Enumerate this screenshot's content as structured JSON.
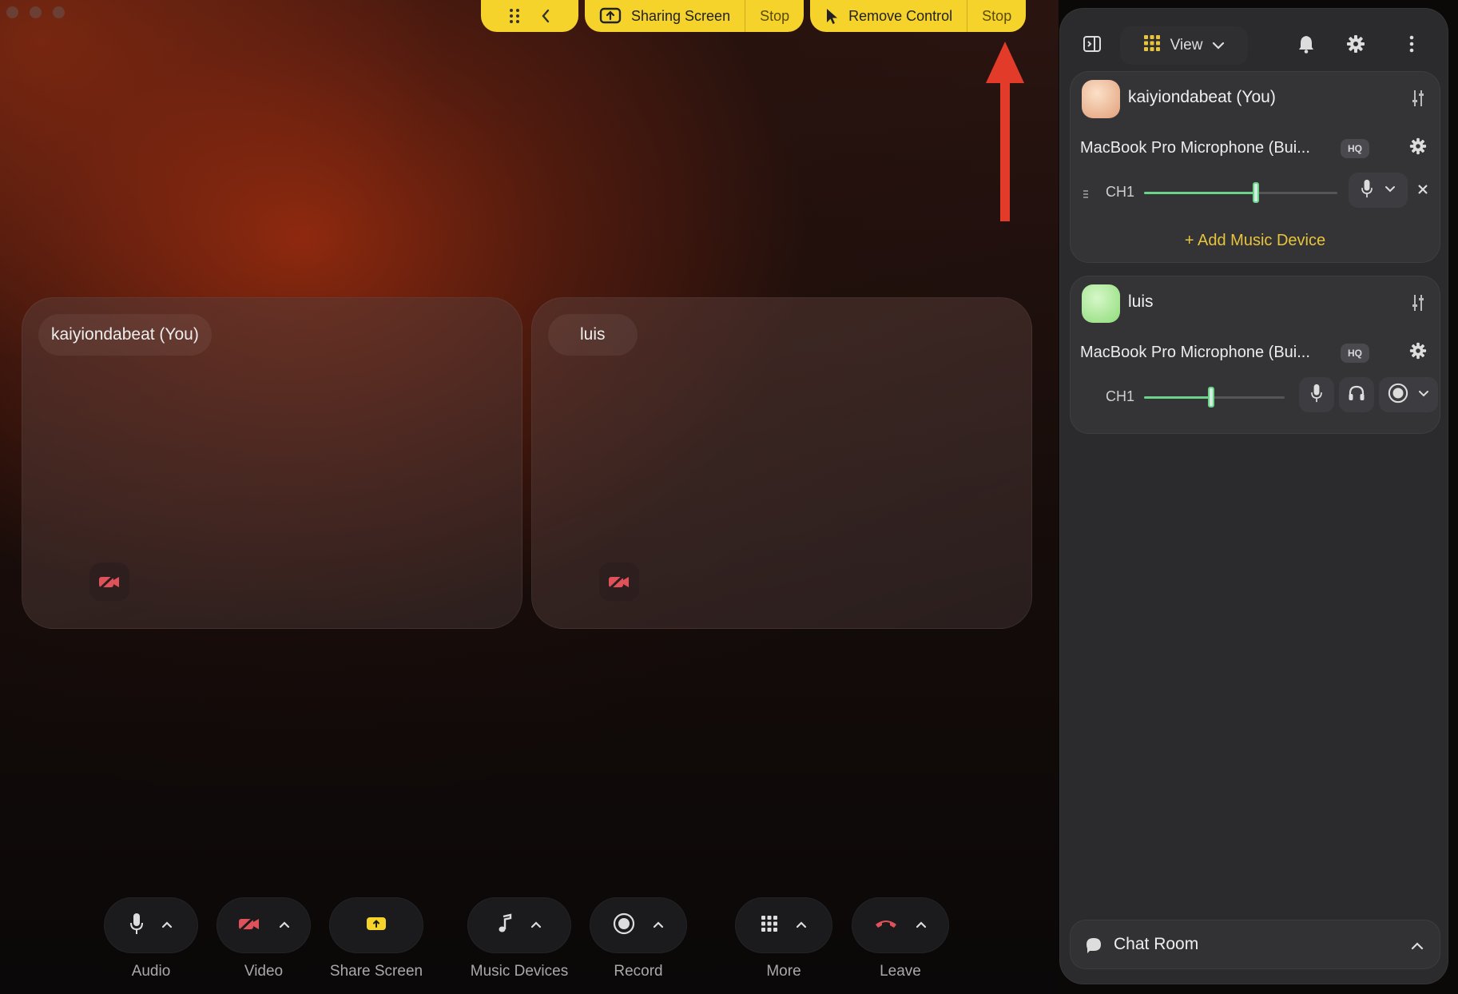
{
  "topbar": {
    "sharing_label": "Sharing Screen",
    "sharing_stop": "Stop",
    "control_label": "Remove Control",
    "control_stop": "Stop"
  },
  "tiles": [
    {
      "name": "kaiyiondabeat (You)"
    },
    {
      "name": "luis"
    }
  ],
  "toolbar": {
    "audio": "Audio",
    "video": "Video",
    "share": "Share Screen",
    "music": "Music Devices",
    "record": "Record",
    "more": "More",
    "leave": "Leave"
  },
  "panel": {
    "view_label": "View",
    "participants": [
      {
        "name": "kaiyiondabeat (You)",
        "device": "MacBook Pro Microphone (Bui...",
        "badge": "HQ",
        "channel": "CH1",
        "level": 0.58,
        "add_label": "+ Add Music Device"
      },
      {
        "name": "luis",
        "device": "MacBook Pro Microphone (Bui...",
        "badge": "HQ",
        "channel": "CH1",
        "level": 0.48
      }
    ],
    "chat_label": "Chat Room"
  },
  "colors": {
    "accent_yellow": "#f5d32a",
    "annotation_red": "#e23b2a",
    "slider_green": "#6bd38a",
    "mute_red": "#e0525a"
  }
}
